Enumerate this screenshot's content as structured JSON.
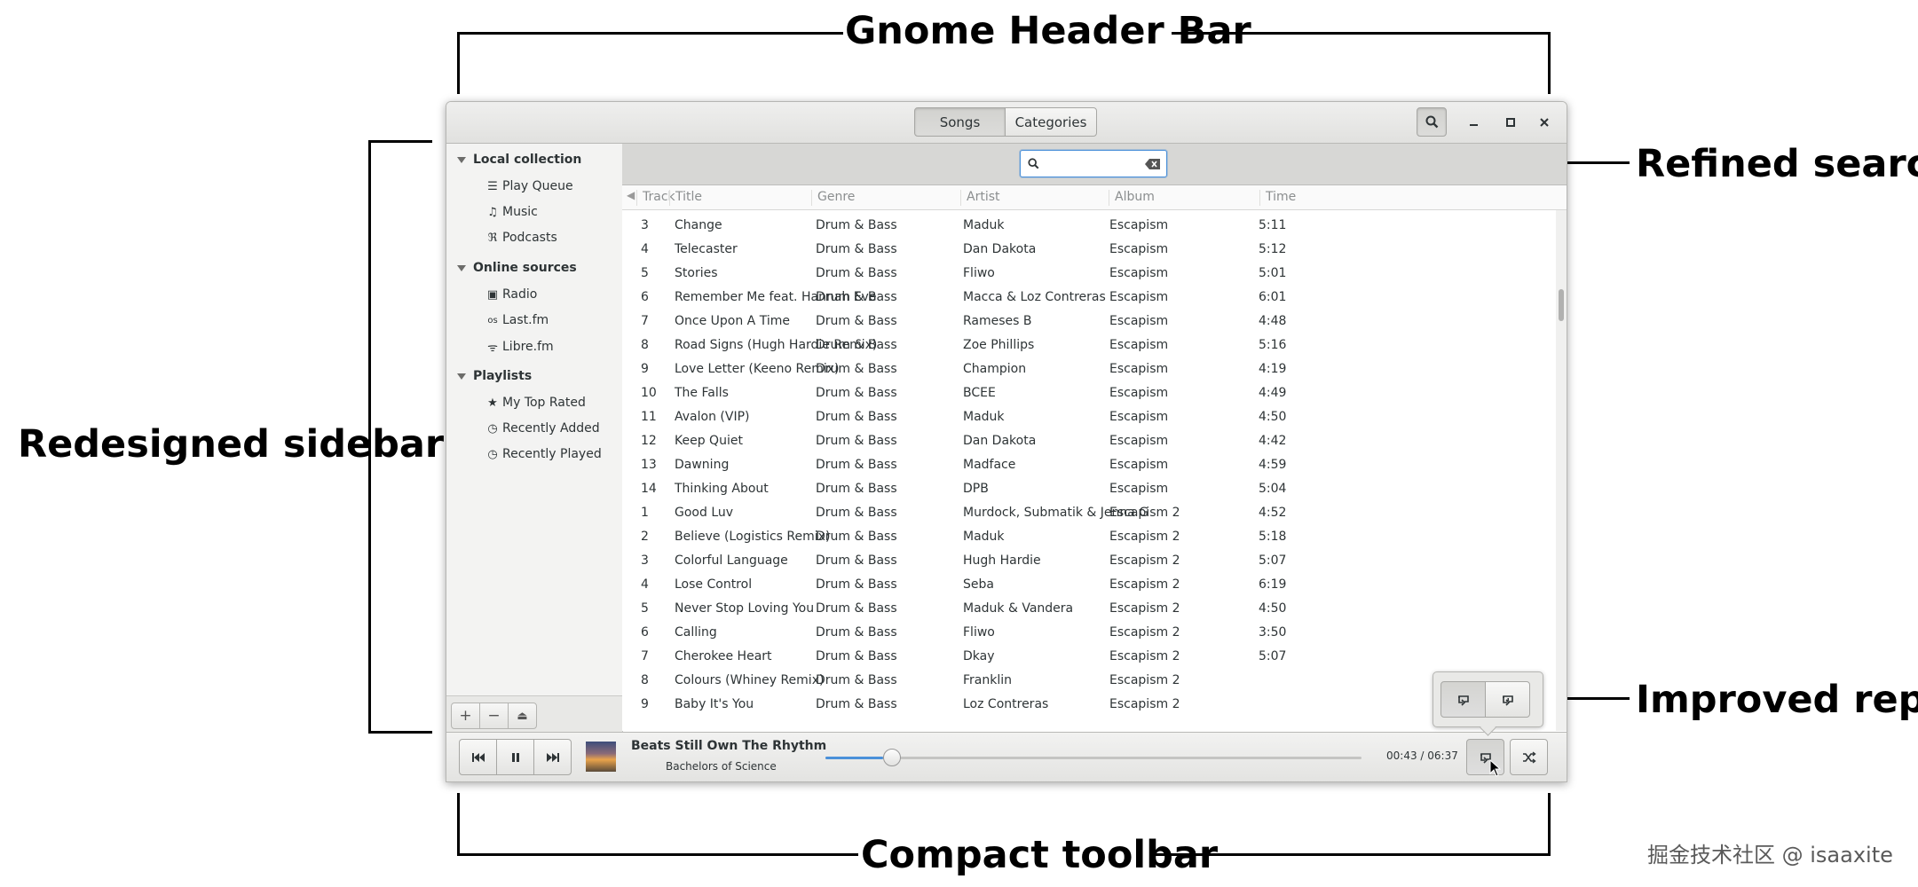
{
  "callouts": {
    "header_bar": "Gnome Header Bar",
    "search": "Refined search",
    "sidebar": "Redesigned sidebar",
    "repeat": "Improved repeat",
    "toolbar": "Compact toolbar"
  },
  "watermark": "掘金技术社区 @ isaaxite",
  "header": {
    "tabs": [
      {
        "label": "Songs",
        "active": true
      },
      {
        "label": "Categories",
        "active": false
      }
    ]
  },
  "sidebar": {
    "sections": [
      {
        "label": "Local collection",
        "items": [
          {
            "label": "Play Queue",
            "icon": "list-icon"
          },
          {
            "label": "Music",
            "icon": "music-note-icon"
          },
          {
            "label": "Podcasts",
            "icon": "rss-icon"
          }
        ]
      },
      {
        "label": "Online sources",
        "items": [
          {
            "label": "Radio",
            "icon": "radio-icon"
          },
          {
            "label": "Last.fm",
            "icon": "lastfm-icon"
          },
          {
            "label": "Libre.fm",
            "icon": "antenna-icon"
          }
        ]
      },
      {
        "label": "Playlists",
        "items": [
          {
            "label": "My Top Rated",
            "icon": "star-icon"
          },
          {
            "label": "Recently Added",
            "icon": "smart-playlist-icon"
          },
          {
            "label": "Recently Played",
            "icon": "smart-playlist-icon"
          }
        ]
      }
    ]
  },
  "search": {
    "value": ""
  },
  "columns": [
    "Track",
    "Title",
    "Genre",
    "Artist",
    "Album",
    "Time"
  ],
  "tracks": [
    {
      "track": "3",
      "title": "Change",
      "genre": "Drum & Bass",
      "artist": "Maduk",
      "album": "Escapism",
      "time": "5:11"
    },
    {
      "track": "4",
      "title": "Telecaster",
      "genre": "Drum & Bass",
      "artist": "Dan Dakota",
      "album": "Escapism",
      "time": "5:12"
    },
    {
      "track": "5",
      "title": "Stories",
      "genre": "Drum & Bass",
      "artist": "Fliwo",
      "album": "Escapism",
      "time": "5:01"
    },
    {
      "track": "6",
      "title": "Remember Me feat. Hannah Eve",
      "genre": "Drum & Bass",
      "artist": "Macca & Loz Contreras",
      "album": "Escapism",
      "time": "6:01"
    },
    {
      "track": "7",
      "title": "Once Upon A Time",
      "genre": "Drum & Bass",
      "artist": "Rameses B",
      "album": "Escapism",
      "time": "4:48"
    },
    {
      "track": "8",
      "title": "Road Signs (Hugh Hardie Remix)",
      "genre": "Drum & Bass",
      "artist": "Zoe Phillips",
      "album": "Escapism",
      "time": "5:16"
    },
    {
      "track": "9",
      "title": "Love Letter (Keeno Remix)",
      "genre": "Drum & Bass",
      "artist": "Champion",
      "album": "Escapism",
      "time": "4:19"
    },
    {
      "track": "10",
      "title": "The Falls",
      "genre": "Drum & Bass",
      "artist": "BCEE",
      "album": "Escapism",
      "time": "4:49"
    },
    {
      "track": "11",
      "title": "Avalon (VIP)",
      "genre": "Drum & Bass",
      "artist": "Maduk",
      "album": "Escapism",
      "time": "4:50"
    },
    {
      "track": "12",
      "title": "Keep Quiet",
      "genre": "Drum & Bass",
      "artist": "Dan Dakota",
      "album": "Escapism",
      "time": "4:42"
    },
    {
      "track": "13",
      "title": "Dawning",
      "genre": "Drum & Bass",
      "artist": "Madface",
      "album": "Escapism",
      "time": "4:59"
    },
    {
      "track": "14",
      "title": "Thinking About",
      "genre": "Drum & Bass",
      "artist": "DPB",
      "album": "Escapism",
      "time": "5:04"
    },
    {
      "track": "1",
      "title": "Good Luv",
      "genre": "Drum & Bass",
      "artist": "Murdock, Submatik & Jenna G",
      "album": "Escapism 2",
      "time": "4:52"
    },
    {
      "track": "2",
      "title": "Believe (Logistics Remix)",
      "genre": "Drum & Bass",
      "artist": "Maduk",
      "album": "Escapism 2",
      "time": "5:18"
    },
    {
      "track": "3",
      "title": "Colorful Language",
      "genre": "Drum & Bass",
      "artist": "Hugh Hardie",
      "album": "Escapism 2",
      "time": "5:07"
    },
    {
      "track": "4",
      "title": "Lose Control",
      "genre": "Drum & Bass",
      "artist": "Seba",
      "album": "Escapism 2",
      "time": "6:19"
    },
    {
      "track": "5",
      "title": "Never Stop Loving You",
      "genre": "Drum & Bass",
      "artist": "Maduk & Vandera",
      "album": "Escapism 2",
      "time": "4:50"
    },
    {
      "track": "6",
      "title": "Calling",
      "genre": "Drum & Bass",
      "artist": "Fliwo",
      "album": "Escapism 2",
      "time": "3:50"
    },
    {
      "track": "7",
      "title": "Cherokee Heart",
      "genre": "Drum & Bass",
      "artist": "Dkay",
      "album": "Escapism 2",
      "time": "5:07"
    },
    {
      "track": "8",
      "title": "Colours (Whiney Remix)",
      "genre": "Drum & Bass",
      "artist": "Franklin",
      "album": "Escapism 2",
      "time": ""
    },
    {
      "track": "9",
      "title": "Baby It's You",
      "genre": "Drum & Bass",
      "artist": "Loz Contreras",
      "album": "Escapism 2",
      "time": ""
    }
  ],
  "player": {
    "title": "Beats Still Own The Rhythm",
    "artist": "Bachelors of Science",
    "time": "00:43 / 06:37",
    "progress": 0.108
  }
}
